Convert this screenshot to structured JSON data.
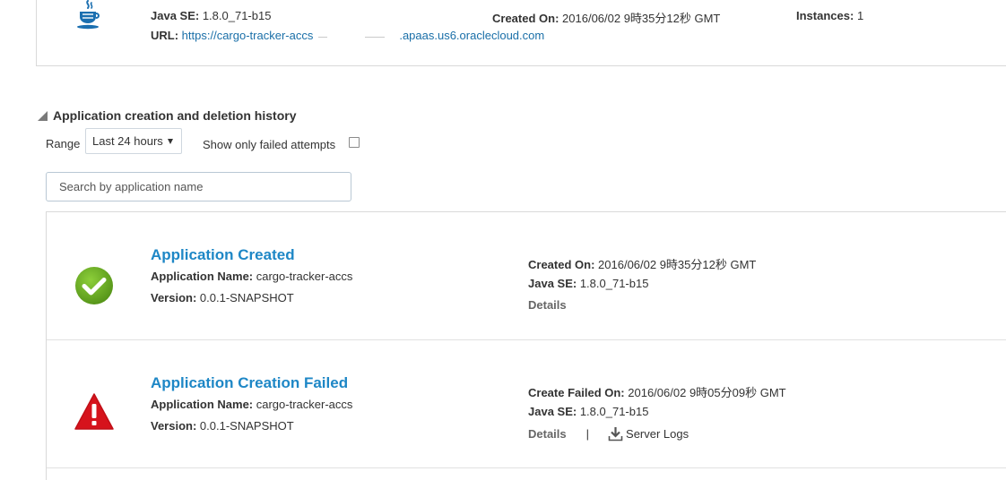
{
  "app_summary": {
    "java_se_label": "Java SE:",
    "java_se_value": "1.8.0_71-b15",
    "created_on_label": "Created On:",
    "created_on_value": "2016/06/02 9時35分12秒 GMT",
    "instances_label": "Instances:",
    "instances_value": "1",
    "url_label": "URL:",
    "url_prefix": "https://cargo-tracker-accs",
    "url_suffix": ".apaas.us6.oraclecloud.com"
  },
  "history": {
    "title": "Application creation and deletion history",
    "range_label": "Range",
    "range_value": "Last 24 hours",
    "failed_only_label": "Show only failed attempts",
    "failed_only_checked": false,
    "search_placeholder": "Search by application name",
    "entries": [
      {
        "status": "success",
        "title": "Application Created",
        "app_name_label": "Application Name:",
        "app_name_value": "cargo-tracker-accs",
        "version_label": "Version:",
        "version_value": "0.0.1-SNAPSHOT",
        "time_label": "Created On:",
        "time_value": "2016/06/02 9時35分12秒 GMT",
        "java_label": "Java SE:",
        "java_value": "1.8.0_71-b15",
        "details_label": "Details"
      },
      {
        "status": "failed",
        "title": "Application Creation Failed",
        "app_name_label": "Application Name:",
        "app_name_value": "cargo-tracker-accs",
        "version_label": "Version:",
        "version_value": "0.0.1-SNAPSHOT",
        "time_label": "Create Failed On:",
        "time_value": "2016/06/02 9時05分09秒 GMT",
        "java_label": "Java SE:",
        "java_value": "1.8.0_71-b15",
        "details_label": "Details",
        "separator": "|",
        "server_logs_label": "Server Logs"
      }
    ]
  },
  "colors": {
    "link": "#1a6fa8",
    "entry_title": "#1e87c6",
    "success_icon": "#6aaa22",
    "error_icon": "#d6131c"
  },
  "icons": {
    "runtime": "java-cup-icon",
    "success": "check-circle-icon",
    "failure": "warning-triangle-icon",
    "download": "download-icon",
    "collapse": "collapse-triangle-icon",
    "dropdown": "caret-down-icon"
  }
}
